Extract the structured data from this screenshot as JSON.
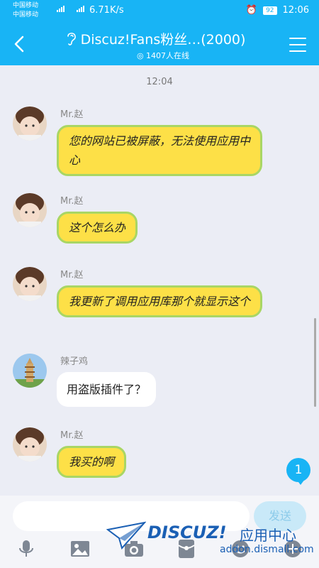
{
  "status_bar": {
    "carrier1": "中国移动",
    "carrier2": "中国移动",
    "net_speed": "6.71K/s",
    "battery": "92",
    "time": "12:06"
  },
  "header": {
    "title": "Discuz!Fans粉丝…(2000)",
    "online": "1407人在线"
  },
  "chat": {
    "timestamp": "12:04",
    "messages": [
      {
        "sender": "Mr.赵",
        "text": "您的网站已被屏蔽，无法使用应用中心"
      },
      {
        "sender": "Mr.赵",
        "text": "这个怎么办"
      },
      {
        "sender": "Mr.赵",
        "text": "我更新了调用应用库那个就显示这个"
      },
      {
        "sender": "辣子鸡",
        "text": "用盗版插件了？"
      },
      {
        "sender": "Mr.赵",
        "text": "我买的啊"
      }
    ]
  },
  "unread_badge": "1",
  "input_bar": {
    "placeholder": "",
    "send_label": "发送"
  },
  "toolbar_icons": [
    "microphone-icon",
    "image-icon",
    "camera-icon",
    "red-packet-icon",
    "emoji-icon",
    "plus-icon"
  ],
  "watermark": {
    "brand": "DISCUZ!",
    "cn": "应用中心",
    "url": "addon.dismall.com"
  },
  "colors": {
    "accent": "#18b4f5",
    "bubble_yellow": "#fde047",
    "bubble_border": "#a9d664"
  }
}
